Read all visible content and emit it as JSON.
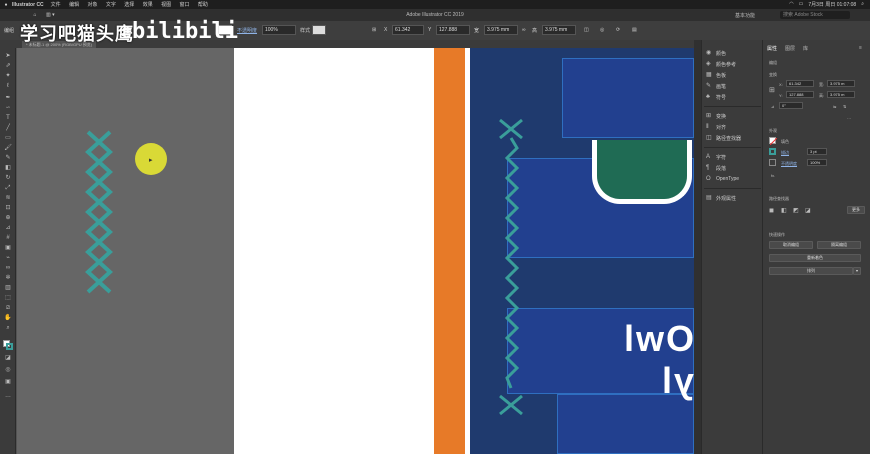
{
  "mac_menubar": {
    "app_name": "Illustrator CC",
    "menus": [
      "文件",
      "编辑",
      "对象",
      "文字",
      "选择",
      "效果",
      "视图",
      "窗口",
      "帮助"
    ],
    "clock": "7月3日 周日 01:07:08"
  },
  "app_bar": {
    "window_title": "Adobe Illustrator CC 2019",
    "workspace": "基本功能",
    "search_placeholder": "搜索 Adobe Stock"
  },
  "control_bar": {
    "no_selection": "编组",
    "opacity_label": "不透明度",
    "opacity_value": "100%",
    "style_label": "样式",
    "x_label": "X",
    "x_value": "61.342",
    "y_label": "Y",
    "y_value": "127.888",
    "w_label": "宽",
    "w_value": "3.975 mm",
    "h_label": "高",
    "h_value": "3.975 mm"
  },
  "doc_tab": {
    "label": "* 未标题-1 @ 200% (RGB/GPU 预览)"
  },
  "watermark": {
    "text": "学习吧猫头鹰",
    "logo": "bilibili"
  },
  "artwork": {
    "mirrored_text": "Owl yl",
    "colors": {
      "orange": "#e77a28",
      "navy": "#1f3a6e",
      "blue": "#22408f",
      "green": "#1f6b54",
      "teal": "#3a9e9a",
      "cursor": "#d9d936"
    }
  },
  "left_panel": {
    "items": [
      {
        "icon": "color-icon",
        "label": "颜色"
      },
      {
        "icon": "color-guide-icon",
        "label": "颜色参考"
      },
      {
        "icon": "swatches-icon",
        "label": "色板"
      },
      {
        "icon": "brushes-icon",
        "label": "画笔"
      },
      {
        "icon": "symbols-icon",
        "label": "符号"
      },
      {
        "icon": "transform-icon",
        "label": "变换"
      },
      {
        "icon": "align-icon",
        "label": "对齐"
      },
      {
        "icon": "pathfinder-icon",
        "label": "路径查找器"
      },
      {
        "icon": "character-icon",
        "label": "字符"
      },
      {
        "icon": "paragraph-icon",
        "label": "段落"
      },
      {
        "icon": "opentype-icon",
        "label": "OpenType"
      },
      {
        "icon": "appearance-icon",
        "label": "外观属性"
      }
    ]
  },
  "properties_panel": {
    "tabs": [
      "属性",
      "图层",
      "库"
    ],
    "group_label": "编组",
    "transform_label": "变换",
    "x_value": "61.342",
    "y_value": "127.888",
    "w_value": "3.975 m",
    "h_value": "3.975 m",
    "angle_value": "0°",
    "appearance_label": "外观",
    "fill_label": "填色",
    "stroke_label": "描边",
    "stroke_value": "3 pt",
    "opacity_label": "不透明度",
    "opacity_value": "100%",
    "fx_label": "fx.",
    "pathfinder_label": "路径查找器",
    "quick_actions_label": "快速操作",
    "btn_ungroup": "取消编组",
    "btn_isolate": "隔离编组",
    "btn_recolor": "重新着色",
    "btn_arrange": "排列",
    "btn_more": "更多"
  }
}
